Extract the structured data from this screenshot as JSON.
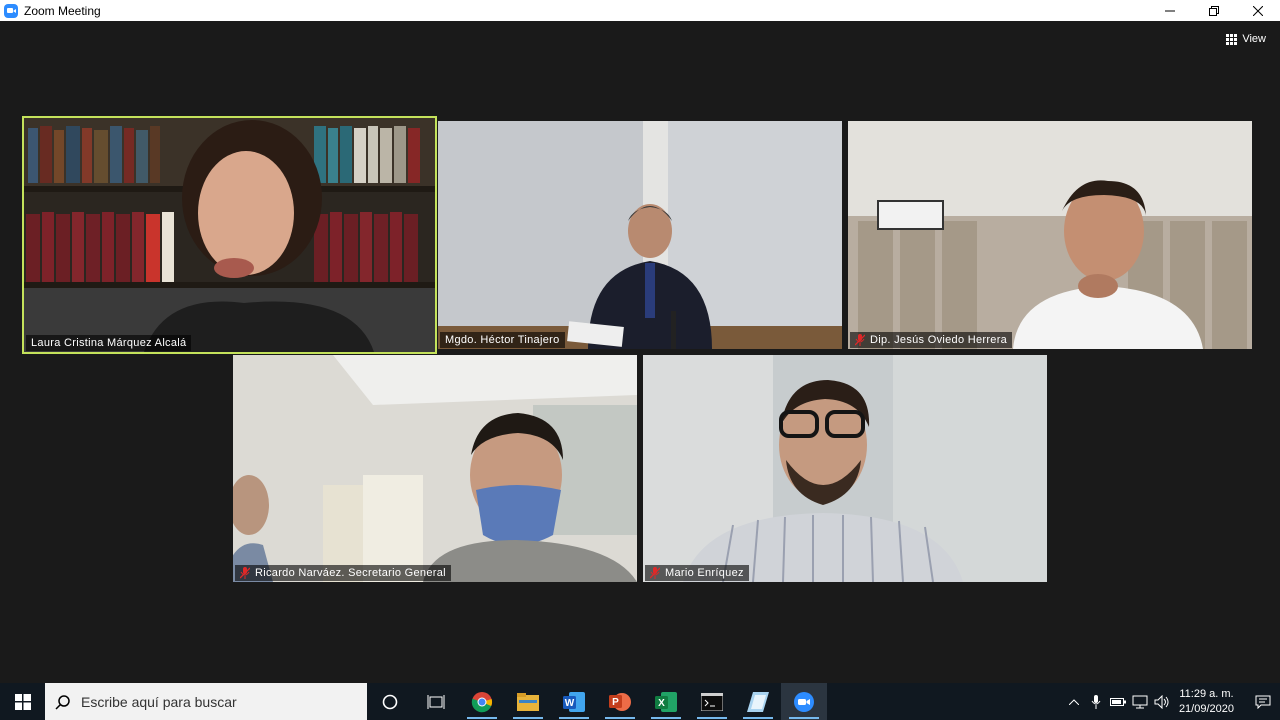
{
  "window": {
    "title": "Zoom Meeting"
  },
  "toolbar": {
    "view_label": "View"
  },
  "participants": [
    {
      "name": "Laura Cristina Márquez Alcalá",
      "muted": false,
      "active_speaker": true
    },
    {
      "name": "Mgdo. Héctor Tinajero",
      "muted": false,
      "active_speaker": false
    },
    {
      "name": "Dip. Jesús Oviedo Herrera",
      "muted": true,
      "active_speaker": false
    },
    {
      "name": "Ricardo Narváez. Secretario General",
      "muted": true,
      "active_speaker": false
    },
    {
      "name": "Mario Enríquez",
      "muted": true,
      "active_speaker": false
    }
  ],
  "taskbar": {
    "search_placeholder": "Escribe aquí para buscar",
    "apps": [
      "cortana-icon",
      "task-view-icon",
      "chrome-icon",
      "file-explorer-icon",
      "word-icon",
      "powerpoint-icon",
      "excel-icon",
      "terminal-icon",
      "notes-icon",
      "zoom-icon"
    ],
    "clock_time": "11:29 a. m.",
    "clock_date": "21/09/2020"
  },
  "colors": {
    "active_speaker_border": "#c4e25b",
    "muted_mic": "#e02828",
    "zoom_blue": "#2d8cff"
  }
}
